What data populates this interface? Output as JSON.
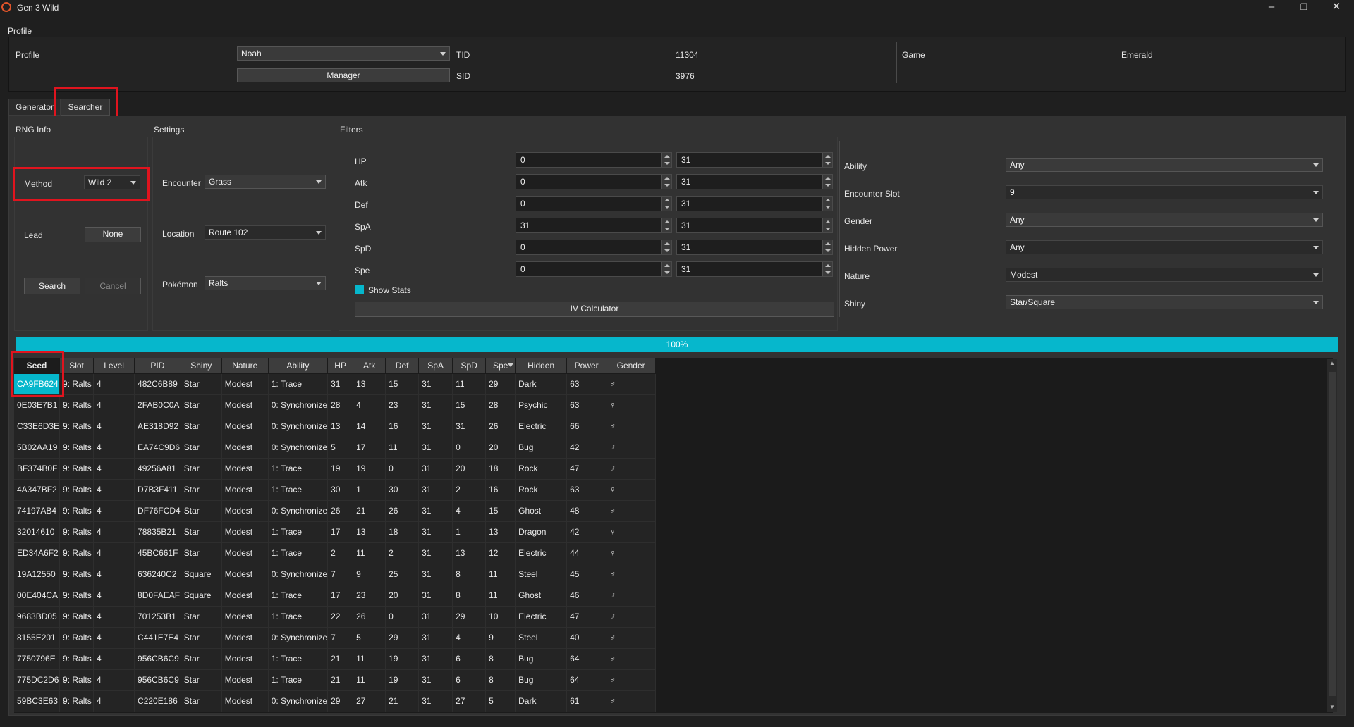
{
  "window": {
    "title": "Gen 3 Wild"
  },
  "profile": {
    "group_label": "Profile",
    "profile_label": "Profile",
    "profile_value": "Noah",
    "manager_label": "Manager",
    "tid_label": "TID",
    "tid_value": "11304",
    "sid_label": "SID",
    "sid_value": "3976",
    "game_label": "Game",
    "game_value": "Emerald"
  },
  "tabs": [
    "Generator",
    "Searcher"
  ],
  "rng_info": {
    "title": "RNG Info",
    "method_label": "Method",
    "method_value": "Wild 2",
    "lead_label": "Lead",
    "lead_value": "None",
    "search_label": "Search",
    "cancel_label": "Cancel"
  },
  "settings": {
    "title": "Settings",
    "encounter_label": "Encounter",
    "encounter_value": "Grass",
    "location_label": "Location",
    "location_value": "Route 102",
    "pokemon_label": "Pokémon",
    "pokemon_value": "Ralts"
  },
  "filters": {
    "title": "Filters",
    "ivs": [
      {
        "label": "HP",
        "min": "0",
        "max": "31"
      },
      {
        "label": "Atk",
        "min": "0",
        "max": "31"
      },
      {
        "label": "Def",
        "min": "0",
        "max": "31"
      },
      {
        "label": "SpA",
        "min": "31",
        "max": "31"
      },
      {
        "label": "SpD",
        "min": "0",
        "max": "31"
      },
      {
        "label": "Spe",
        "min": "0",
        "max": "31"
      }
    ],
    "show_stats_label": "Show Stats",
    "iv_calc_label": "IV Calculator",
    "ability_label": "Ability",
    "ability_value": "Any",
    "slot_label": "Encounter Slot",
    "slot_value": "9",
    "gender_label": "Gender",
    "gender_value": "Any",
    "hp_label": "Hidden Power",
    "hp_value": "Any",
    "nature_label": "Nature",
    "nature_value": "Modest",
    "shiny_label": "Shiny",
    "shiny_value": "Star/Square"
  },
  "progress": {
    "text": "100%",
    "value": 1.0
  },
  "results": {
    "columns": [
      "Seed",
      "Slot",
      "Level",
      "PID",
      "Shiny",
      "Nature",
      "Ability",
      "HP",
      "Atk",
      "Def",
      "SpA",
      "SpD",
      "Spe",
      "Hidden",
      "Power",
      "Gender"
    ],
    "rows": [
      [
        "CA9FB624",
        "9: Ralts",
        "4",
        "482C6B89",
        "Star",
        "Modest",
        "1: Trace",
        "31",
        "13",
        "15",
        "31",
        "11",
        "29",
        "Dark",
        "63",
        "♂"
      ],
      [
        "0E03E7B1",
        "9: Ralts",
        "4",
        "2FAB0C0A",
        "Star",
        "Modest",
        "0: Synchronize",
        "28",
        "4",
        "23",
        "31",
        "15",
        "28",
        "Psychic",
        "63",
        "♀"
      ],
      [
        "C33E6D3E",
        "9: Ralts",
        "4",
        "AE318D92",
        "Star",
        "Modest",
        "0: Synchronize",
        "13",
        "14",
        "16",
        "31",
        "31",
        "26",
        "Electric",
        "66",
        "♂"
      ],
      [
        "5B02AA19",
        "9: Ralts",
        "4",
        "EA74C9D6",
        "Star",
        "Modest",
        "0: Synchronize",
        "5",
        "17",
        "11",
        "31",
        "0",
        "20",
        "Bug",
        "42",
        "♂"
      ],
      [
        "BF374B0F",
        "9: Ralts",
        "4",
        "49256A81",
        "Star",
        "Modest",
        "1: Trace",
        "19",
        "19",
        "0",
        "31",
        "20",
        "18",
        "Rock",
        "47",
        "♂"
      ],
      [
        "4A347BF2",
        "9: Ralts",
        "4",
        "D7B3F411",
        "Star",
        "Modest",
        "1: Trace",
        "30",
        "1",
        "30",
        "31",
        "2",
        "16",
        "Rock",
        "63",
        "♀"
      ],
      [
        "74197AB4",
        "9: Ralts",
        "4",
        "DF76FCD4",
        "Star",
        "Modest",
        "0: Synchronize",
        "26",
        "21",
        "26",
        "31",
        "4",
        "15",
        "Ghost",
        "48",
        "♂"
      ],
      [
        "32014610",
        "9: Ralts",
        "4",
        "78835B21",
        "Star",
        "Modest",
        "1: Trace",
        "17",
        "13",
        "18",
        "31",
        "1",
        "13",
        "Dragon",
        "42",
        "♀"
      ],
      [
        "ED34A6F2",
        "9: Ralts",
        "4",
        "45BC661F",
        "Star",
        "Modest",
        "1: Trace",
        "2",
        "11",
        "2",
        "31",
        "13",
        "12",
        "Electric",
        "44",
        "♀"
      ],
      [
        "19A12550",
        "9: Ralts",
        "4",
        "636240C2",
        "Square",
        "Modest",
        "0: Synchronize",
        "7",
        "9",
        "25",
        "31",
        "8",
        "11",
        "Steel",
        "45",
        "♂"
      ],
      [
        "00E404CA",
        "9: Ralts",
        "4",
        "8D0FAEAF",
        "Square",
        "Modest",
        "1: Trace",
        "17",
        "23",
        "20",
        "31",
        "8",
        "11",
        "Ghost",
        "46",
        "♂"
      ],
      [
        "9683BD05",
        "9: Ralts",
        "4",
        "701253B1",
        "Star",
        "Modest",
        "1: Trace",
        "22",
        "26",
        "0",
        "31",
        "29",
        "10",
        "Electric",
        "47",
        "♂"
      ],
      [
        "8155E201",
        "9: Ralts",
        "4",
        "C441E7E4",
        "Star",
        "Modest",
        "0: Synchronize",
        "7",
        "5",
        "29",
        "31",
        "4",
        "9",
        "Steel",
        "40",
        "♂"
      ],
      [
        "7750796E",
        "9: Ralts",
        "4",
        "956CB6C9",
        "Star",
        "Modest",
        "1: Trace",
        "21",
        "11",
        "19",
        "31",
        "6",
        "8",
        "Bug",
        "64",
        "♂"
      ],
      [
        "775DC2D6",
        "9: Ralts",
        "4",
        "956CB6C9",
        "Star",
        "Modest",
        "1: Trace",
        "21",
        "11",
        "19",
        "31",
        "6",
        "8",
        "Bug",
        "64",
        "♂"
      ],
      [
        "59BC3E63",
        "9: Ralts",
        "4",
        "C220E186",
        "Star",
        "Modest",
        "0: Synchronize",
        "29",
        "27",
        "21",
        "31",
        "27",
        "5",
        "Dark",
        "61",
        "♂"
      ]
    ]
  },
  "colors": {
    "accent": "#06b7cc",
    "highlight": "#e0141e",
    "background": "#1f1f1f"
  }
}
